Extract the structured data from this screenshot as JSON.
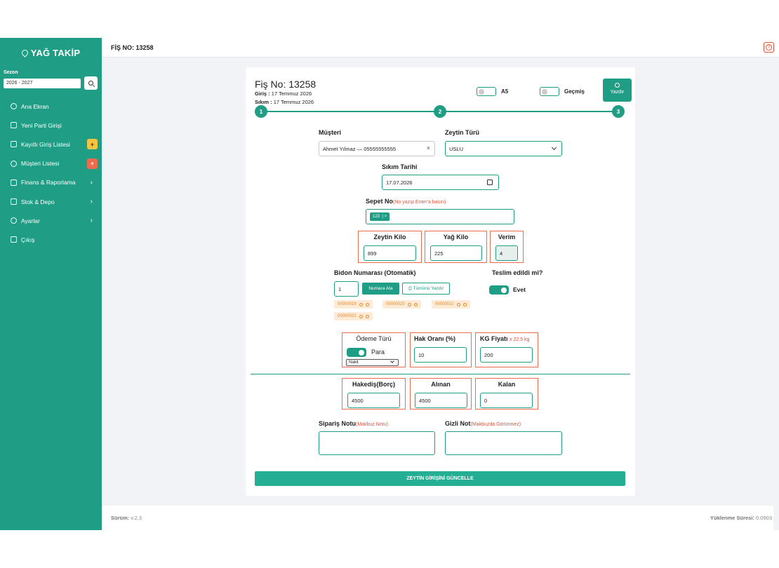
{
  "app": {
    "logo_text": "YAĞ TAKİP"
  },
  "sidebar": {
    "sezon_label": "Sezon",
    "sezon_value": "2026 - 2027",
    "items": [
      {
        "label": "Ana Ekran",
        "icon": "dashboard-icon"
      },
      {
        "label": "Yeni Parti Girişi",
        "icon": "document-icon"
      },
      {
        "label": "Kayıtlı Giriş Listesi",
        "icon": "chart-icon",
        "badge": "add-file-icon"
      },
      {
        "label": "Müşteri Listesi",
        "icon": "users-icon",
        "badge": "add-user-icon"
      },
      {
        "label": "Finans & Raporlama",
        "icon": "finance-icon",
        "chevron": "›"
      },
      {
        "label": "Stok & Depo",
        "icon": "box-icon",
        "chevron": "›"
      },
      {
        "label": "Ayarlar",
        "icon": "gear-icon",
        "chevron": "›"
      },
      {
        "label": "Çıkış",
        "icon": "logout-icon"
      }
    ]
  },
  "header": {
    "title": "FİŞ NO: 13258",
    "help_symbol": "?"
  },
  "card": {
    "title": "Fiş No: 13258",
    "giris_label": "Giriş :",
    "giris_value": "17 Temmuz 2026",
    "sikim_label": "Sıkım :",
    "sikim_value": "17 Temmuz 2026",
    "toggle_a5": "A5",
    "toggle_gecmis": "Geçmiş",
    "print_label": "Yazdır",
    "steps": [
      "1",
      "2",
      "3"
    ]
  },
  "form": {
    "musteri_label": "Müşteri",
    "musteri_value": "Ahmet Yılmaz — 05555555555",
    "musteri_clear": "×",
    "zeytin_turu_label": "Zeytin Türü",
    "zeytin_turu_value": "USLU",
    "sikim_tarihi_label": "Sıkım Tarihi",
    "sikim_tarihi_value": "17.07.2026",
    "sepet_label": "Sepet No",
    "sepet_hint": "(No yazıp Enter'a basın)",
    "sepet_tag": "123",
    "sepet_tag_remove": "×",
    "zeytin_kilo_label": "Zeytin Kilo",
    "zeytin_kilo_value": "899",
    "yag_kilo_label": "Yağ Kilo",
    "yag_kilo_value": "225",
    "verim_label": "Verim",
    "verim_value": "4",
    "bidon_label": "Bidon Numarası (Otomatik)",
    "bidon_count": "1",
    "numara_ata": "Numara Ata",
    "tumunu_yazdir": "Tümünü Yazdır",
    "bidon_chips": [
      "00000019",
      "00000020",
      "00000021",
      "00000022"
    ],
    "teslim_label": "Teslim edildi mi?",
    "teslim_value": "Evet",
    "odeme_turu_label": "Ödeme Türü",
    "odeme_switch_label": "Para",
    "odeme_select": "Nakit",
    "hak_orani_label": "Hak Oranı (%)",
    "hak_orani_value": "10",
    "kg_fiyati_label": "KG Fiyatı",
    "kg_fiyati_hint": "x 22.5 kg",
    "kg_fiyati_value": "200",
    "hakedis_label": "Hakediş(Borç)",
    "hakedis_value": "4500",
    "alinan_label": "Alınan",
    "alinan_value": "4500",
    "kalan_label": "Kalan",
    "kalan_value": "0",
    "siparis_notu_label": "Sipariş Notu",
    "siparis_notu_hint": "(Makbuz Notu)",
    "gizli_not_label": "Gizli Not",
    "gizli_not_hint": "(Makbuzda Görünmez)",
    "submit_label": "ZEYTİN GİRİŞİNİ GÜNCELLE"
  },
  "footer": {
    "version_label": "Sürüm:",
    "version_value": "v.2.3",
    "load_label": "Yüklenme Süresi:",
    "load_value": "0.0903"
  },
  "colors": {
    "primary": "#1f9e85",
    "accent_red": "#ef6b4e",
    "chip_bg": "#fdebd6"
  }
}
